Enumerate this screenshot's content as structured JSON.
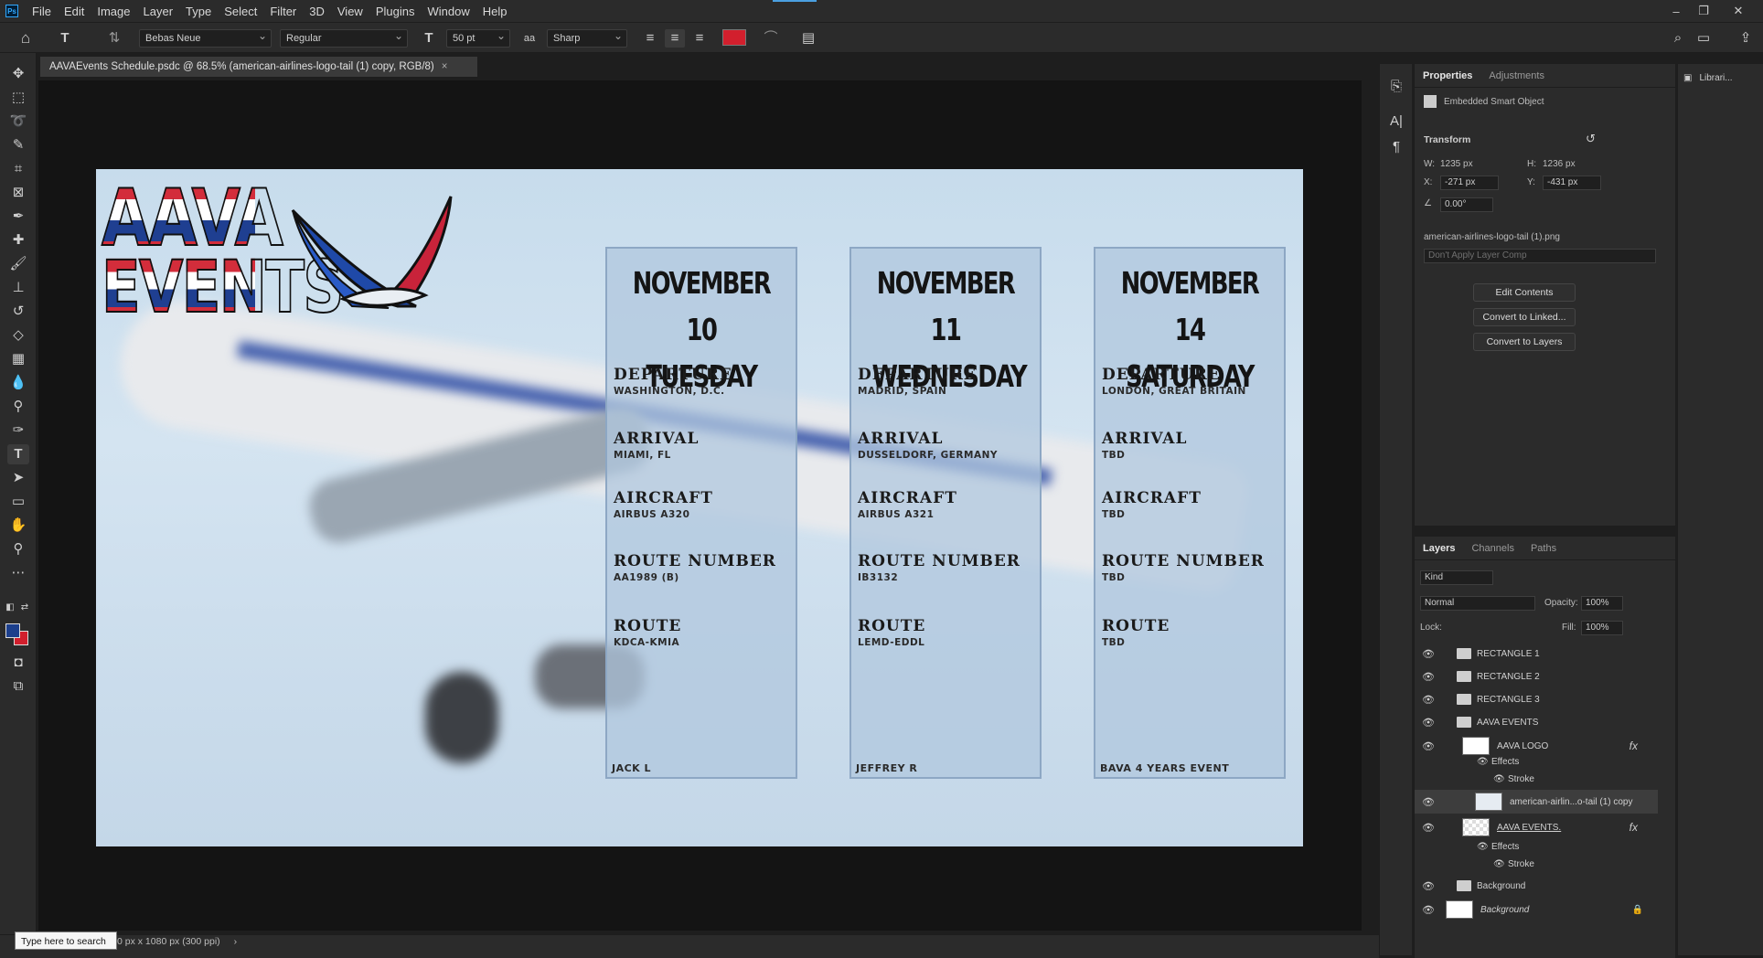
{
  "app": {
    "logo": "Ps"
  },
  "menu": [
    "File",
    "Edit",
    "Image",
    "Layer",
    "Type",
    "Select",
    "Filter",
    "3D",
    "View",
    "Plugins",
    "Window",
    "Help"
  ],
  "window_controls": [
    "–",
    "❐",
    "✕"
  ],
  "options_bar": {
    "font_family": "Bebas Neue",
    "font_style": "Regular",
    "font_size": "50 pt",
    "antialias_icon": "aa",
    "antialias": "Sharp",
    "text_color": "#d21f2d"
  },
  "document_tab": {
    "title": "AAVAEvents Schedule.psdc @ 68.5% (american-airlines-logo-tail (1) copy, RGB/8)",
    "close": "×"
  },
  "artboard": {
    "logo_line1": "AAVA",
    "logo_line2": "EVENTS",
    "columns": [
      {
        "date": "NOVEMBER 10",
        "day": "TUESDAY",
        "departure_label": "DEPARTURE",
        "departure": "WASHINGTON, D.C.",
        "arrival_label": "ARRIVAL",
        "arrival": "MIAMI, FL",
        "aircraft_label": "AIRCRAFT",
        "aircraft": "AIRBUS A320",
        "route_number_label": "ROUTE NUMBER",
        "route_number": "AA1989 (B)",
        "route_label": "ROUTE",
        "route": "KDCA-KMIA",
        "footer": "JACK L"
      },
      {
        "date": "NOVEMBER 11",
        "day": "WEDNESDAY",
        "departure_label": "DEPARTURE",
        "departure": "MADRID, SPAIN",
        "arrival_label": "ARRIVAL",
        "arrival": "DUSSELDORF, GERMANY",
        "aircraft_label": "AIRCRAFT",
        "aircraft": "AIRBUS A321",
        "route_number_label": "ROUTE NUMBER",
        "route_number": "IB3132",
        "route_label": "ROUTE",
        "route": "LEMD-EDDL",
        "footer": "JEFFREY R"
      },
      {
        "date": "NOVEMBER 14",
        "day": "SATURDAY",
        "departure_label": "DEPARTURE",
        "departure": "LONDON, GREAT BRITAIN",
        "arrival_label": "ARRIVAL",
        "arrival": "TBD",
        "aircraft_label": "AIRCRAFT",
        "aircraft": "TBD",
        "route_number_label": "ROUTE NUMBER",
        "route_number": "TBD",
        "route_label": "ROUTE",
        "route": "TBD",
        "footer": "BAVA 4 YEARS EVENT"
      }
    ]
  },
  "properties": {
    "tabs": [
      "Properties",
      "Adjustments"
    ],
    "object_type": "Embedded Smart Object",
    "section": "Transform",
    "w_label": "W:",
    "w": "1235 px",
    "h_label": "H:",
    "h": "1236 px",
    "x_label": "X:",
    "x": "-271 px",
    "y_label": "Y:",
    "y": "-431 px",
    "angle": "0.00°",
    "filename": "american-airlines-logo-tail (1).png",
    "layer_comp": "Don't Apply Layer Comp",
    "buttons": [
      "Edit Contents",
      "Convert to Linked...",
      "Convert to Layers"
    ]
  },
  "libraries": {
    "label": "Librari..."
  },
  "layers_panel": {
    "tabs": [
      "Layers",
      "Channels",
      "Paths"
    ],
    "kind": "Kind",
    "blend_mode": "Normal",
    "opacity_label": "Opacity:",
    "opacity": "100%",
    "lock_label": "Lock:",
    "fill_label": "Fill:",
    "fill": "100%",
    "rows": [
      {
        "name": "RECTANGLE 1",
        "type": "group"
      },
      {
        "name": "RECTANGLE 2",
        "type": "group"
      },
      {
        "name": "RECTANGLE 3",
        "type": "group"
      },
      {
        "name": "AAVA EVENTS",
        "type": "group-open"
      },
      {
        "name": "AAVA LOGO",
        "type": "layer",
        "fx": "fx"
      },
      {
        "name": "Effects",
        "type": "effects"
      },
      {
        "name": "Stroke",
        "type": "effect"
      },
      {
        "name": "american-airlin...o-tail (1) copy",
        "type": "smart",
        "selected": true
      },
      {
        "name": "AAVA EVENTS.",
        "type": "layer",
        "fx": "fx"
      },
      {
        "name": "Effects",
        "type": "effects"
      },
      {
        "name": "Stroke",
        "type": "effect"
      },
      {
        "name": "Background",
        "type": "group"
      },
      {
        "name": "Background",
        "type": "background"
      }
    ]
  },
  "status": {
    "search_placeholder": "Type here to search",
    "doc_info": "0 px x 1080 px (300 ppi)",
    "arrow": "›"
  }
}
